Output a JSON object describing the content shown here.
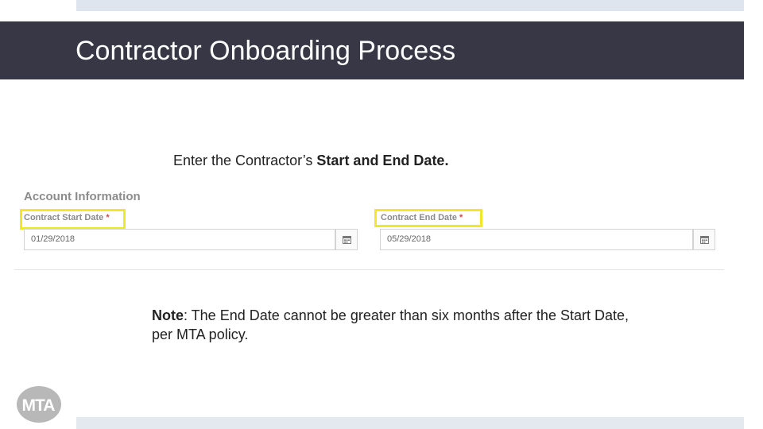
{
  "slide": {
    "title": "Contractor Onboarding Process",
    "instruction": {
      "prefix": "Enter the Contractor’s ",
      "bold": "Start and End Date."
    },
    "note": {
      "label": "Note",
      "text": ": The End Date cannot be greater than six months after the Start Date, per MTA policy."
    }
  },
  "form": {
    "section_title": "Account Information",
    "start_label": "Contract Start Date",
    "start_value": "01/29/2018",
    "end_label": "Contract End Date",
    "end_value": "05/29/2018",
    "required_marker": "*"
  },
  "logo": {
    "text": "MTA"
  },
  "colors": {
    "title_bar": "#383745",
    "highlight": "#f2e82a",
    "logo": "#b8b8b8"
  },
  "icons": {
    "calendar": "calendar-icon"
  }
}
